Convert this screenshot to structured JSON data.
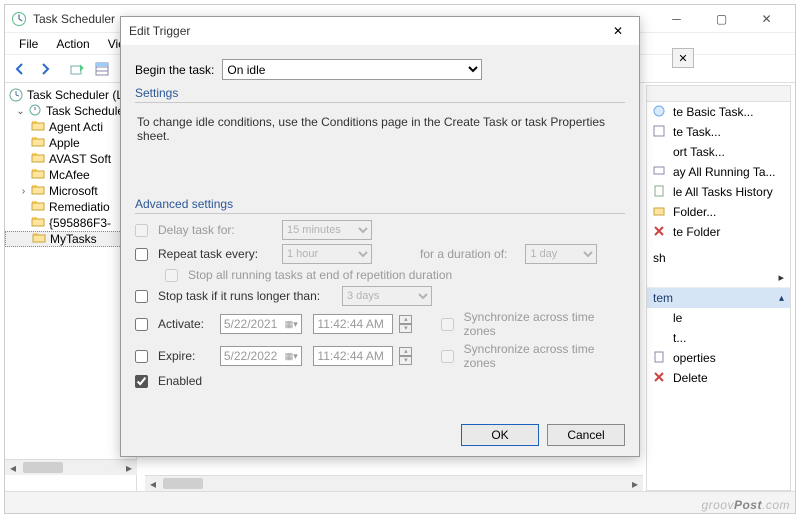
{
  "window": {
    "title": "Task Scheduler",
    "menu": [
      "File",
      "Action",
      "View"
    ]
  },
  "tree": {
    "root": "Task Scheduler (Lo",
    "library": "Task Scheduler",
    "items": [
      "Agent Acti",
      "Apple",
      "AVAST Soft",
      "McAfee",
      "Microsoft",
      "Remediatio",
      "{595886F3-",
      "MyTasks"
    ]
  },
  "actions": {
    "upper_items": [
      "te Basic Task...",
      "te Task...",
      "ort Task...",
      "ay All Running Ta...",
      "le All Tasks History",
      "Folder...",
      "te Folder"
    ],
    "refresh": "sh",
    "header2": "tem",
    "lower_items": [
      "le",
      "t...",
      "operties",
      "Delete"
    ]
  },
  "dialog": {
    "title": "Edit Trigger",
    "begin_label": "Begin the task:",
    "begin_value": "On idle",
    "settings_label": "Settings",
    "settings_text": "To change idle conditions, use the Conditions page in the Create Task or task Properties sheet.",
    "advanced_label": "Advanced settings",
    "delay_label": "Delay task for:",
    "delay_value": "15 minutes",
    "repeat_label": "Repeat task every:",
    "repeat_value": "1 hour",
    "duration_label": "for a duration of:",
    "duration_value": "1 day",
    "stop_all_label": "Stop all running tasks at end of repetition duration",
    "stop_if_label": "Stop task if it runs longer than:",
    "stop_if_value": "3 days",
    "activate_label": "Activate:",
    "activate_date": "5/22/2021",
    "activate_time": "11:42:44 AM",
    "expire_label": "Expire:",
    "expire_date": "5/22/2022",
    "expire_time": "11:42:44 AM",
    "sync_label": "Synchronize across time zones",
    "enabled_label": "Enabled",
    "ok": "OK",
    "cancel": "Cancel"
  },
  "watermark": {
    "a": "groov",
    "b": "Post",
    "c": ".com"
  }
}
